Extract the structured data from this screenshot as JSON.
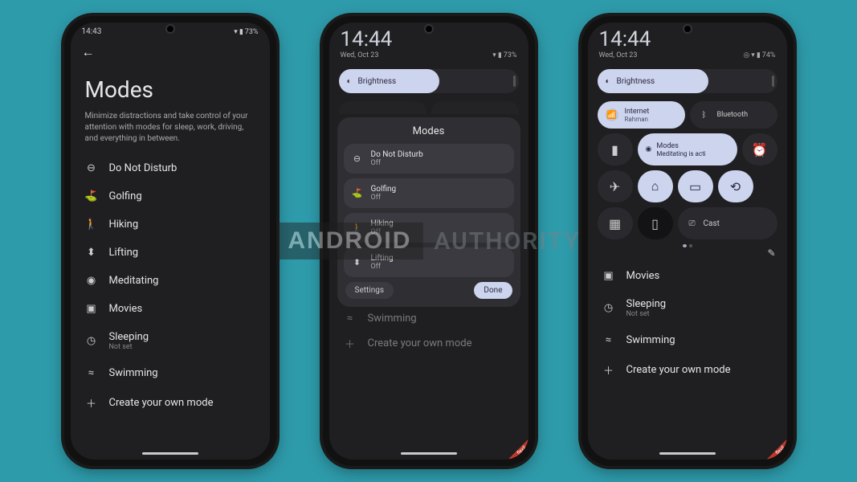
{
  "watermark": {
    "logo": "ANDROID",
    "text": "AUTHORITY"
  },
  "phone1": {
    "status": {
      "time": "14:43",
      "battery": "73%"
    },
    "title": "Modes",
    "description": "Minimize distractions and take control of your attention with modes for sleep, work, driving, and everything in between.",
    "items": [
      {
        "icon": "dnd",
        "label": "Do Not Disturb"
      },
      {
        "icon": "golf",
        "label": "Golfing"
      },
      {
        "icon": "hike",
        "label": "Hiking"
      },
      {
        "icon": "lift",
        "label": "Lifting"
      },
      {
        "icon": "meditate",
        "label": "Meditating"
      },
      {
        "icon": "movie",
        "label": "Movies"
      },
      {
        "icon": "sleep",
        "label": "Sleeping",
        "sub": "Not set"
      },
      {
        "icon": "swim",
        "label": "Swimming"
      },
      {
        "icon": "plus",
        "label": "Create your own mode"
      }
    ]
  },
  "phone2": {
    "clock": {
      "time": "14:44",
      "date": "Wed, Oct 23",
      "battery": "73%"
    },
    "brightness_label": "Brightness",
    "panel_title": "Modes",
    "panel_items": [
      {
        "icon": "dnd",
        "name": "Do Not Disturb",
        "state": "Off"
      },
      {
        "icon": "golf",
        "name": "Golfing",
        "state": "Off"
      },
      {
        "icon": "hike",
        "name": "Hiking",
        "state": "Off"
      },
      {
        "icon": "lift",
        "name": "Lifting",
        "state": "Off"
      }
    ],
    "settings_label": "Settings",
    "done_label": "Done",
    "dim": [
      {
        "icon": "swim",
        "label": "Swimming"
      },
      {
        "icon": "plus",
        "label": "Create your own mode"
      }
    ]
  },
  "phone3": {
    "clock": {
      "time": "14:44",
      "date": "Wed, Oct 23",
      "battery": "74%"
    },
    "brightness_label": "Brightness",
    "tiles": {
      "internet": {
        "title": "Internet",
        "sub": "Rahman"
      },
      "bluetooth": "Bluetooth",
      "modes": {
        "title": "Modes",
        "sub": "Meditating is acti"
      },
      "cast": "Cast"
    },
    "list": [
      {
        "icon": "movie",
        "label": "Movies"
      },
      {
        "icon": "sleep",
        "label": "Sleeping",
        "sub": "Not set"
      },
      {
        "icon": "swim",
        "label": "Swimming"
      },
      {
        "icon": "plus",
        "label": "Create your own mode"
      }
    ],
    "flexil": "flexil"
  }
}
